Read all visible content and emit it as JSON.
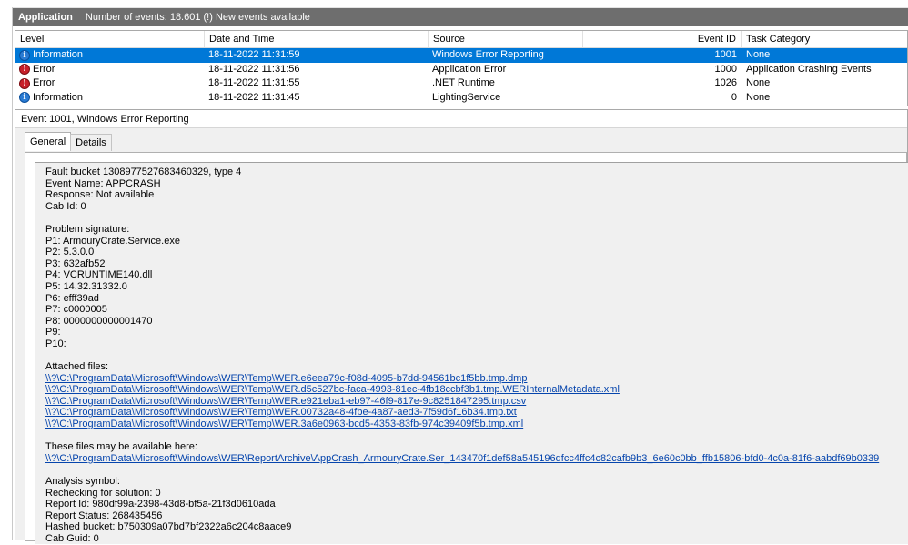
{
  "header": {
    "title": "Application",
    "info": "Number of events: 18.601 (!) New events available"
  },
  "grid": {
    "columns": [
      "Level",
      "Date and Time",
      "Source",
      "Event ID",
      "Task Category"
    ],
    "rows": [
      {
        "icon": "information-icon",
        "level": "Information",
        "date": "18-11-2022 11:31:59",
        "source": "Windows Error Reporting",
        "id": "1001",
        "category": "None"
      },
      {
        "icon": "error-icon",
        "level": "Error",
        "date": "18-11-2022 11:31:56",
        "source": "Application Error",
        "id": "1000",
        "category": "Application Crashing Events"
      },
      {
        "icon": "error-icon",
        "level": "Error",
        "date": "18-11-2022 11:31:55",
        "source": ".NET Runtime",
        "id": "1026",
        "category": "None"
      },
      {
        "icon": "information-icon",
        "level": "Information",
        "date": "18-11-2022 11:31:45",
        "source": "LightingService",
        "id": "0",
        "category": "None"
      }
    ],
    "selected_row": 0
  },
  "event": {
    "title": "Event 1001, Windows Error Reporting",
    "tabs": [
      "General",
      "Details"
    ],
    "active_tab": "General",
    "lines": [
      "Fault bucket 1308977527683460329, type 4",
      "Event Name: APPCRASH",
      "Response: Not available",
      "Cab Id: 0",
      "",
      "Problem signature:",
      "P1: ArmouryCrate.Service.exe",
      "P2: 5.3.0.0",
      "P3: 632afb52",
      "P4: VCRUNTIME140.dll",
      "P5: 14.32.31332.0",
      "P6: efff39ad",
      "P7: c0000005",
      "P8: 0000000000001470",
      "P9:",
      "P10:",
      "",
      "Attached files:"
    ],
    "attached_files": [
      "\\\\?\\C:\\ProgramData\\Microsoft\\Windows\\WER\\Temp\\WER.e6eea79c-f08d-4095-b7dd-94561bc1f5bb.tmp.dmp",
      "\\\\?\\C:\\ProgramData\\Microsoft\\Windows\\WER\\Temp\\WER.d5c527bc-faca-4993-81ec-4fb18ccbf3b1.tmp.WERInternalMetadata.xml",
      "\\\\?\\C:\\ProgramData\\Microsoft\\Windows\\WER\\Temp\\WER.e921eba1-eb97-46f9-817e-9c8251847295.tmp.csv",
      "\\\\?\\C:\\ProgramData\\Microsoft\\Windows\\WER\\Temp\\WER.00732a48-4fbe-4a87-aed3-7f59d6f16b34.tmp.txt",
      "\\\\?\\C:\\ProgramData\\Microsoft\\Windows\\WER\\Temp\\WER.3a6e0963-bcd5-4353-83fb-974c39409f5b.tmp.xml"
    ],
    "available_label": "These files may be available here:",
    "archive_link": "\\\\?\\C:\\ProgramData\\Microsoft\\Windows\\WER\\ReportArchive\\AppCrash_ArmouryCrate.Ser_143470f1def58a545196dfcc4ffc4c82cafb9b3_6e60c0bb_ffb15806-bfd0-4c0a-81f6-aabdf69b0339",
    "analysis_lines": [
      "Analysis symbol:",
      "Rechecking for solution: 0",
      "Report Id: 980df99a-2398-43d8-bf5a-21f3d0610ada",
      "Report Status: 268435456",
      "Hashed bucket: b750309a07bd7bf2322a6c204c8aace9",
      "Cab Guid: 0"
    ]
  },
  "colors": {
    "selection": "#0078d7",
    "header": "#6e6e6e",
    "link": "#0645ad"
  }
}
